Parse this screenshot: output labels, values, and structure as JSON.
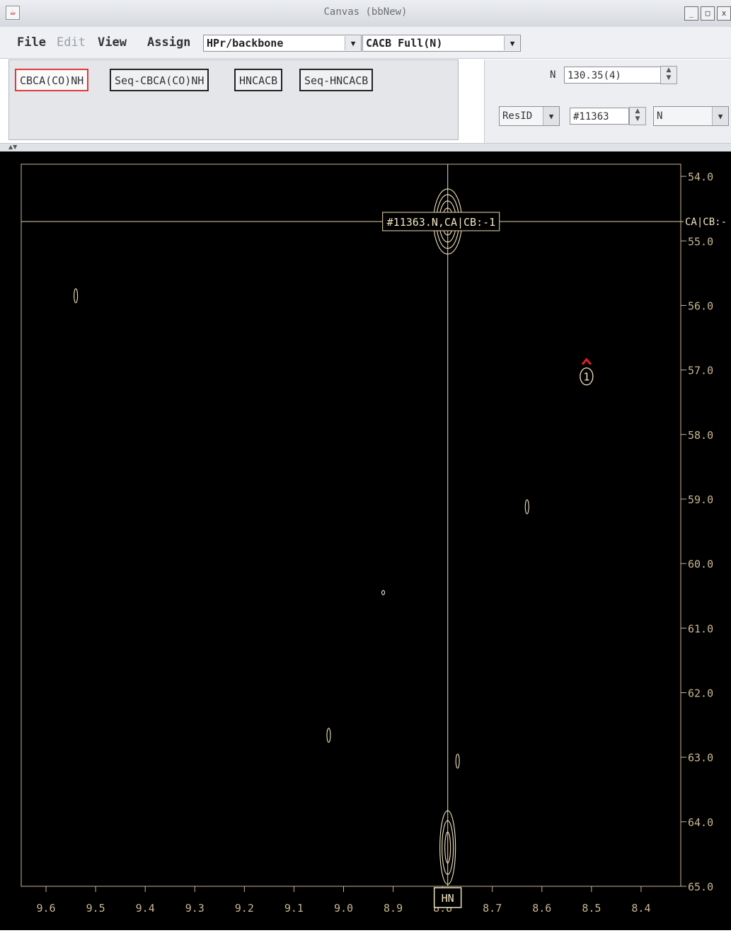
{
  "window": {
    "title": "Canvas (bbNew)",
    "buttons": [
      "_",
      "□",
      "x"
    ]
  },
  "menu": {
    "file": "File",
    "edit": "Edit",
    "view": "View",
    "assign": "Assign",
    "project_combo": "HPr/backbone",
    "mode_combo": "CACB Full(N)"
  },
  "toolbar": {
    "buttons": [
      "CBCA(CO)NH",
      "Seq-CBCA(CO)NH",
      "HNCACB",
      "Seq-HNCACB"
    ],
    "active": "CBCA(CO)NH"
  },
  "navigator": {
    "n_label": "N",
    "n_value": "130.35(4)",
    "resid_combo": "ResID",
    "resid_value": "#11363",
    "atom_combo": "N"
  },
  "spectrum": {
    "background": "#000000",
    "contour_color": "#f3e4c0",
    "axis_color": "#c8b692",
    "marker_color": "#e02020",
    "crosshair_label": "#11363.N,CA|CB:-1",
    "right_cursor_label": "CA|CB:-",
    "x_axis_label": "HN",
    "peak_marker_label": "1",
    "x_ticks": [
      "9.6",
      "9.5",
      "9.4",
      "9.3",
      "9.2",
      "9.1",
      "9.0",
      "8.9",
      "8.8",
      "8.7",
      "8.6",
      "8.5",
      "8.4"
    ],
    "y_ticks": [
      "54.0",
      "55.0",
      "56.0",
      "57.0",
      "58.0",
      "59.0",
      "60.0",
      "61.0",
      "62.0",
      "63.0",
      "64.0",
      "65.0"
    ],
    "x_range_ppm": [
      9.65,
      8.32
    ],
    "y_range_ppm": [
      53.9,
      65.0
    ],
    "crosshair": {
      "hn": 8.79,
      "ca": 54.7
    },
    "peaks": [
      {
        "hn": 8.79,
        "ca": 54.7,
        "type": "strong"
      },
      {
        "hn": 9.54,
        "ca": 55.85,
        "type": "weak"
      },
      {
        "hn": 8.63,
        "ca": 59.12,
        "type": "weak"
      },
      {
        "hn": 8.92,
        "ca": 60.45,
        "type": "dot"
      },
      {
        "hn": 9.03,
        "ca": 62.66,
        "type": "weak"
      },
      {
        "hn": 8.77,
        "ca": 63.06,
        "type": "weak"
      },
      {
        "hn": 8.79,
        "ca": 64.4,
        "type": "tall"
      }
    ],
    "picked_peak": {
      "hn": 8.51,
      "ca": 57.1
    }
  }
}
